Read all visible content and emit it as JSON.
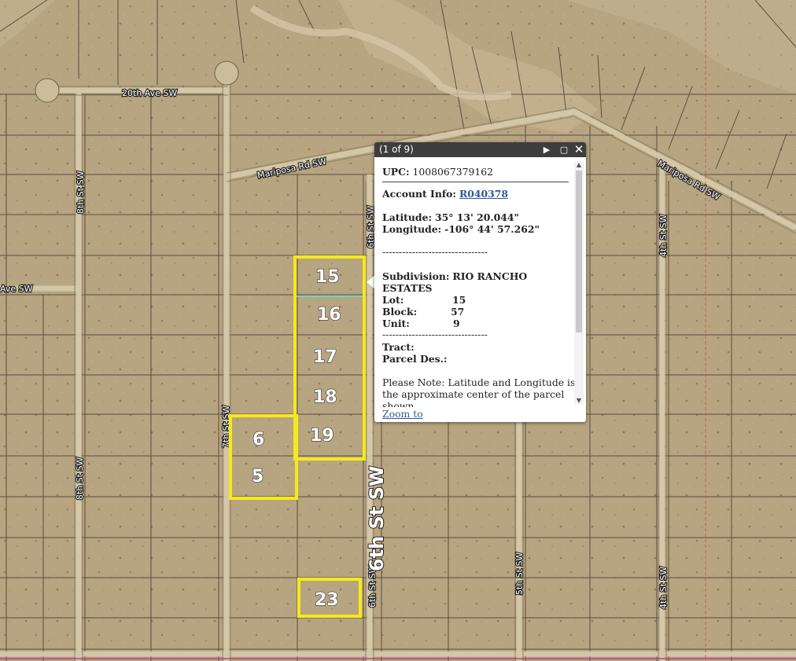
{
  "roads": {
    "ave_20th": "20th Ave SW",
    "mariposa_w": "Mariposa Rd SW",
    "mariposa_e": "Mariposa Rd SW",
    "ave_left": "Ave SW",
    "st_8th_top": "8th St SW",
    "st_8th_bottom": "8th St SW",
    "st_7th": "7th St SW",
    "st_6th_top": "6th St SW",
    "st_6th_bottom": "6th St SW",
    "st_6th_big": "6th St SW",
    "st_5th": "5th St SW",
    "st_4th_top": "4th St SW",
    "st_4th_bottom": "4th St SW"
  },
  "lots": {
    "lot15": "15",
    "lot16": "16",
    "lot17": "17",
    "lot18": "18",
    "lot19": "19",
    "lot6": "6",
    "lot5": "5",
    "lot23": "23"
  },
  "popup": {
    "counter": "(1 of 9)",
    "upc_label": "UPC:",
    "upc_value": "1008067379162",
    "account_label": "Account Info:",
    "account_value": "R040378",
    "lat_label": "Latitude:",
    "lat_value": "35° 13' 20.044\"",
    "lon_label": "Longitude:",
    "lon_value": "-106° 44' 57.262\"",
    "dashes": "--------------------------------",
    "subdivision_label": "Subdivision:",
    "subdivision_value": "RIO RANCHO",
    "subdivision_value2": "ESTATES",
    "lot_label": "Lot:",
    "lot_value": "15",
    "block_label": "Block:",
    "block_value": "57",
    "unit_label": "Unit:",
    "unit_value": "9",
    "dashes2": "--------------------------------",
    "tract_label": "Tract:",
    "parcel_label": "Parcel Des.:",
    "note_line1": "Please Note: Latitude and Longitude is",
    "note_line2": "the approximate center of the parcel",
    "note_line3": "shown.",
    "zoom_to": "Zoom to"
  },
  "colors": {
    "highlight": "#f4ea1a",
    "parcel_line": "#4a3f33",
    "selected_line": "#5ee0e0"
  }
}
